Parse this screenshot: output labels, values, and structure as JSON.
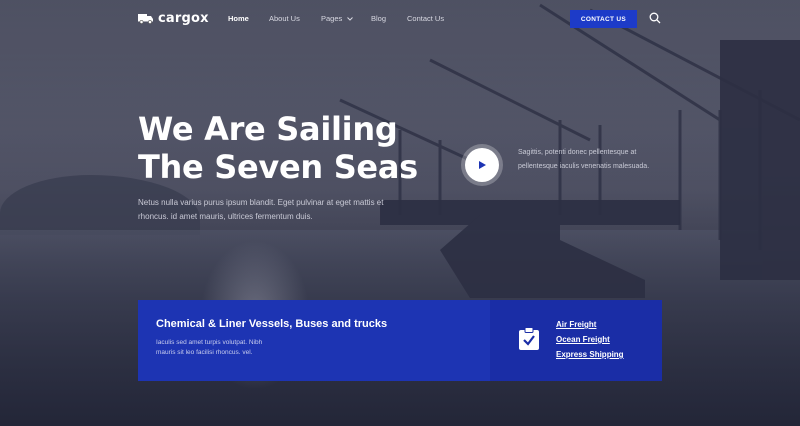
{
  "brand": {
    "name": "cargox",
    "logo_icon": "truck-icon"
  },
  "nav": {
    "items": [
      {
        "label": "Home",
        "active": true
      },
      {
        "label": "About Us"
      },
      {
        "label": "Pages"
      },
      {
        "label": "Blog"
      },
      {
        "label": "Contact Us"
      }
    ],
    "cta_label": "CONTACT US",
    "search_icon": "search-icon"
  },
  "hero": {
    "title_line1": "We Are Sailing",
    "title_line2": "The Seven Seas",
    "subtitle": "Netus nulla varius purus ipsum blandit. Eget pulvinar at eget mattis et rhoncus. id amet mauris, ultrices fermentum duis.",
    "side_text": "Sagittis, potenti donec pellentesque at pellentesque iaculis venenatis malesuada."
  },
  "panel": {
    "title": "Chemical & Liner Vessels, Buses and trucks",
    "description": "Iaculis sed amet turpis volutpat. Nibh mauris sit leo facilisi rhoncus. vel.",
    "links": [
      "Air Freight",
      "Ocean Freight",
      "Express Shipping"
    ]
  },
  "colors": {
    "accent": "#1d3bc8",
    "panel_left": "#1d34b3",
    "panel_right": "#1a2da6"
  }
}
